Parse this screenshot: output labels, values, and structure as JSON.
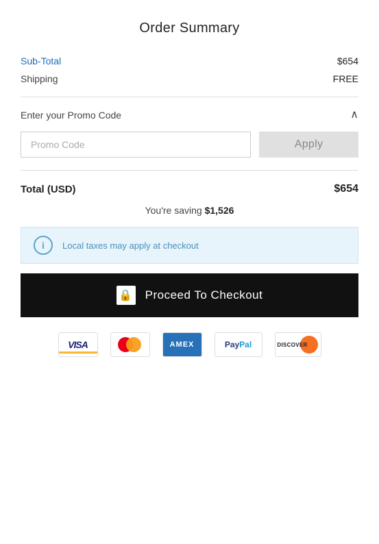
{
  "header": {
    "title": "Order Summary"
  },
  "summary": {
    "subtotal_label": "Sub-Total",
    "subtotal_value": "$654",
    "shipping_label": "Shipping",
    "shipping_value": "FREE"
  },
  "promo": {
    "label": "Enter your Promo Code",
    "input_placeholder": "Promo Code",
    "apply_label": "Apply",
    "chevron": "∧"
  },
  "total": {
    "label": "Total (USD)",
    "value": "$654"
  },
  "saving": {
    "text_prefix": "You're saving ",
    "amount": "$1,526"
  },
  "info_banner": {
    "text": "Local taxes may apply at checkout"
  },
  "checkout": {
    "label": "Proceed To Checkout"
  },
  "payment_methods": [
    "VISA",
    "Mastercard",
    "AmEx",
    "PayPal",
    "Discover"
  ]
}
